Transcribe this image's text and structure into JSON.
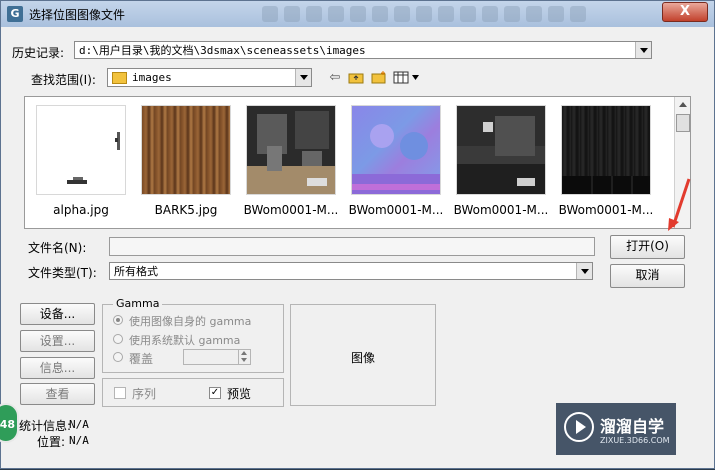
{
  "window": {
    "title": "选择位图图像文件",
    "close_label": "X"
  },
  "history": {
    "label": "历史记录:",
    "value": "d:\\用户目录\\我的文档\\3dsmax\\sceneassets\\images"
  },
  "lookin": {
    "label": "查找范围(I):",
    "value": "images"
  },
  "files": [
    {
      "name": "alpha.jpg"
    },
    {
      "name": "BARK5.jpg"
    },
    {
      "name": "BWom0001-M..."
    },
    {
      "name": "BWom0001-M..."
    },
    {
      "name": "BWom0001-M..."
    },
    {
      "name": "BWom0001-M..."
    }
  ],
  "filename": {
    "label": "文件名(N):",
    "value": ""
  },
  "filetype": {
    "label": "文件类型(T):",
    "value": "所有格式"
  },
  "buttons": {
    "open": "打开(O)",
    "cancel": "取消"
  },
  "side_buttons": {
    "setup1": "设备...",
    "setup2": "设置...",
    "info": "信息...",
    "view": "查看"
  },
  "gamma": {
    "legend": "Gamma",
    "opt1": "使用图像自身的 gamma",
    "opt2": "使用系统默认 gamma",
    "opt3": "覆盖"
  },
  "sequence_label": "序列",
  "preview_check": "预览",
  "preview_checked": true,
  "image_label": "图像",
  "stats": {
    "stat_label": "统计信息:",
    "stat_value": "N/A",
    "pos_label": "位置:",
    "pos_value": "N/A"
  },
  "badge": "48",
  "watermark": {
    "title": "溜溜自学",
    "subtitle": "ZIXUE.3D66.COM"
  },
  "icons": [
    "back-icon",
    "up-folder-icon",
    "new-folder-icon",
    "view-menu-icon"
  ]
}
